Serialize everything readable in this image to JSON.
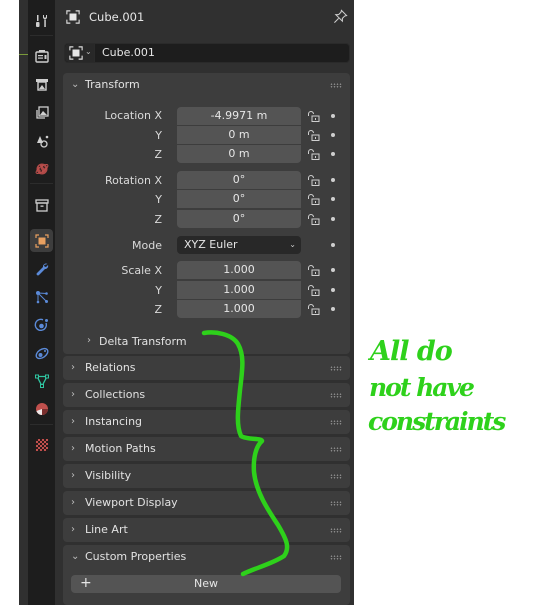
{
  "header": {
    "object_name": "Cube.001",
    "object_icon": "object-icon",
    "pin_icon": "pin-icon"
  },
  "datablock": {
    "type_icon": "object-data-icon",
    "name": "Cube.001"
  },
  "tabs": [
    {
      "name": "tool",
      "icon": "tool-icon",
      "color": "#cfcfcf"
    },
    {
      "name": "render",
      "icon": "render-icon",
      "color": "#cfcfcf"
    },
    {
      "name": "output",
      "icon": "output-icon",
      "color": "#cfcfcf"
    },
    {
      "name": "view-layer",
      "icon": "view-layer-icon",
      "color": "#cfcfcf"
    },
    {
      "name": "scene",
      "icon": "scene-icon",
      "color": "#cfcfcf"
    },
    {
      "name": "world",
      "icon": "world-icon",
      "color": "#c0504d"
    },
    {
      "name": "collection",
      "icon": "collection-icon",
      "color": "#cfcfcf"
    },
    {
      "name": "object",
      "icon": "object-icon",
      "color": "#e8a060",
      "active": true
    },
    {
      "name": "modifiers",
      "icon": "wrench-icon",
      "color": "#5b8ad8"
    },
    {
      "name": "particles",
      "icon": "particles-icon",
      "color": "#5b8ad8"
    },
    {
      "name": "physics",
      "icon": "physics-icon",
      "color": "#5b8ad8"
    },
    {
      "name": "constraints",
      "icon": "constraints-icon",
      "color": "#5b8ad8"
    },
    {
      "name": "data",
      "icon": "mesh-data-icon",
      "color": "#2fc4a0"
    },
    {
      "name": "material",
      "icon": "material-icon",
      "color": "#c0504d"
    },
    {
      "name": "texture",
      "icon": "texture-icon",
      "color": "#c0504d"
    }
  ],
  "transform": {
    "title": "Transform",
    "location": {
      "labels": [
        "Location X",
        "Y",
        "Z"
      ],
      "values": [
        "-4.9971 m",
        "0 m",
        "0 m"
      ]
    },
    "rotation": {
      "labels": [
        "Rotation X",
        "Y",
        "Z"
      ],
      "values": [
        "0°",
        "0°",
        "0°"
      ]
    },
    "mode": {
      "label": "Mode",
      "value": "XYZ Euler"
    },
    "scale": {
      "labels": [
        "Scale X",
        "Y",
        "Z"
      ],
      "values": [
        "1.000",
        "1.000",
        "1.000"
      ]
    },
    "delta_transform": "Delta Transform"
  },
  "panels": [
    {
      "title": "Relations",
      "expanded": false
    },
    {
      "title": "Collections",
      "expanded": false
    },
    {
      "title": "Instancing",
      "expanded": false
    },
    {
      "title": "Motion Paths",
      "expanded": false
    },
    {
      "title": "Visibility",
      "expanded": false
    },
    {
      "title": "Viewport Display",
      "expanded": false
    },
    {
      "title": "Line Art",
      "expanded": false
    },
    {
      "title": "Custom Properties",
      "expanded": true
    }
  ],
  "custom_properties": {
    "new_label": "New"
  },
  "annotation": {
    "lines": [
      "All do",
      "not have",
      "constraints"
    ],
    "color": "#2ed11b"
  },
  "arrows": {
    "collapsed": "›",
    "expanded": "⌄"
  }
}
